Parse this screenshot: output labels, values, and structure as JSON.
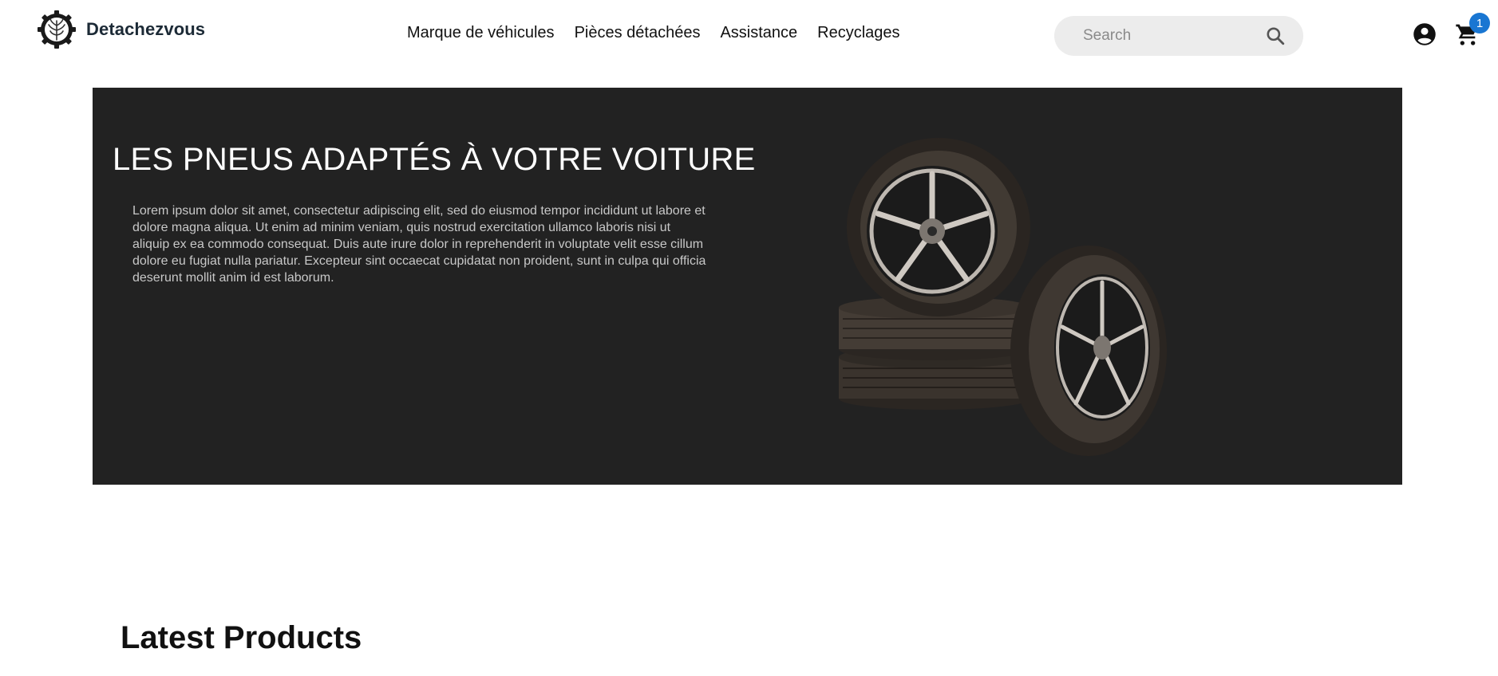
{
  "header": {
    "brand_name": "Detachezvous",
    "nav": [
      {
        "label": "Marque de véhicules"
      },
      {
        "label": "Pièces détachées"
      },
      {
        "label": "Assistance"
      },
      {
        "label": "Recyclages"
      }
    ],
    "search": {
      "placeholder": "Search",
      "value": ""
    },
    "cart_count": "1",
    "icons": {
      "logo": "gear-wheat-logo-icon",
      "search": "search-icon",
      "account": "account-circle-icon",
      "cart": "shopping-cart-icon"
    }
  },
  "hero": {
    "title": "LES PNEUS ADAPTÉS À VOTRE VOITURE",
    "description": "Lorem ipsum dolor sit amet, consectetur adipiscing elit, sed do eiusmod tempor incididunt ut labore et dolore magna aliqua. Ut enim ad minim veniam, quis nostrud exercitation ullamco laboris nisi ut aliquip ex ea commodo consequat. Duis aute irure dolor in reprehenderit in voluptate velit esse cillum dolore eu fugiat nulla pariatur. Excepteur sint occaecat cupidatat non proident, sunt in culpa qui officia deserunt mollit anim id est laborum.",
    "image": "tires-image"
  },
  "sections": {
    "latest_products_title": "Latest Products"
  },
  "colors": {
    "hero_background": "#222222",
    "badge": "#1976d2",
    "search_background": "#ececec"
  }
}
